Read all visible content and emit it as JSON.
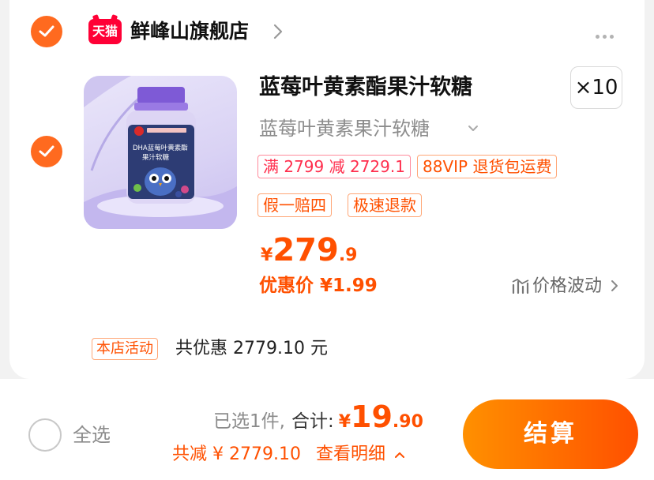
{
  "shop": {
    "logo_text": "天猫",
    "name": "鲜峰山旗舰店"
  },
  "product": {
    "title": "蓝莓叶黄素酯果汁软糖",
    "sku": "蓝莓叶黄素果汁软糖",
    "quantity": "×10",
    "tags": [
      "满 2799 减 2729.1",
      "88VIP 退货包运费",
      "假一赔四",
      "极速退款"
    ],
    "price_yen": "¥",
    "price_int": "279",
    "price_dec": ".9",
    "promo_price": "优惠价 ¥1.99",
    "price_trend": "价格波动",
    "image_label_1": "DHA蓝莓叶黄素酯",
    "image_label_2": "果汁软糖"
  },
  "activity": {
    "tag": "本店活动",
    "text": "共优惠 2779.10 元"
  },
  "bottom": {
    "select_all": "全选",
    "selected_count": "已选1件,",
    "total_label": "合计:",
    "total_yen": "¥",
    "total_int": "19",
    "total_dec": ".90",
    "discount": "共减 ¥ 2779.10",
    "detail": "查看明细",
    "checkout": "结算"
  },
  "colors": {
    "accent": "#ff5000",
    "check": "#ff6a1f",
    "tmall_red": "#ff0036"
  }
}
